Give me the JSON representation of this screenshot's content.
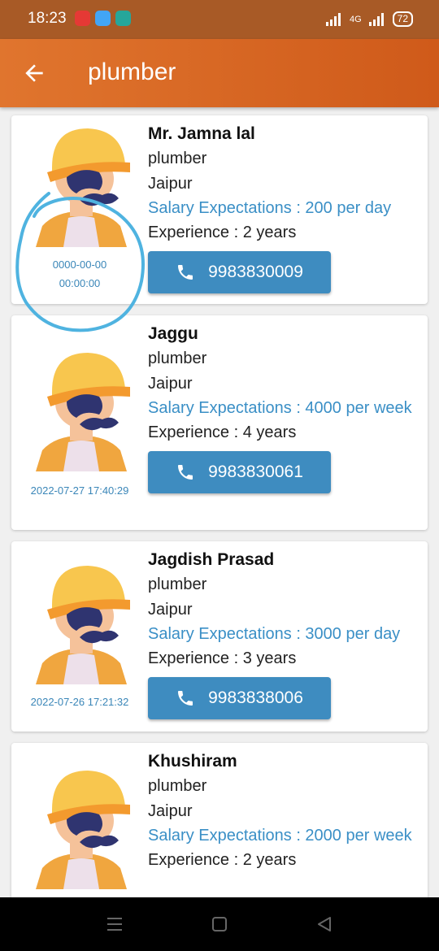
{
  "status": {
    "time": "18:23",
    "network": "4G",
    "battery": "72",
    "app_icon_colors": [
      "#e53935",
      "#42a5f5",
      "#26a69a"
    ]
  },
  "appbar": {
    "title": "plumber",
    "back_icon": "arrow-left-icon"
  },
  "workers": [
    {
      "name": "Mr. Jamna lal",
      "trade": "plumber",
      "city": "Jaipur",
      "salary": "Salary Expectations : 200 per day",
      "experience": "Experience : 2 years",
      "phone": "9983830009",
      "date_line1": "0000-00-00",
      "date_line2": "00:00:00"
    },
    {
      "name": "Jaggu",
      "trade": "plumber",
      "city": "Jaipur",
      "salary": "Salary Expectations : 4000 per week",
      "experience": "Experience : 4 years",
      "phone": "9983830061",
      "date_line1": "2022-07-27 17:40:29",
      "date_line2": ""
    },
    {
      "name": "Jagdish Prasad",
      "trade": "plumber",
      "city": "Jaipur",
      "salary": "Salary Expectations : 3000 per day",
      "experience": "Experience : 3 years",
      "phone": "9983838006",
      "date_line1": "2022-07-26 17:21:32",
      "date_line2": ""
    },
    {
      "name": "Khushiram",
      "trade": "plumber",
      "city": "Jaipur",
      "salary": "Salary Expectations : 2000 per week",
      "experience": "Experience : 2 years",
      "phone": "",
      "date_line1": "",
      "date_line2": ""
    }
  ],
  "colors": {
    "appbar": "#d9662a",
    "accent_blue": "#3e8cc0",
    "salary_text": "#3a8fc6"
  }
}
